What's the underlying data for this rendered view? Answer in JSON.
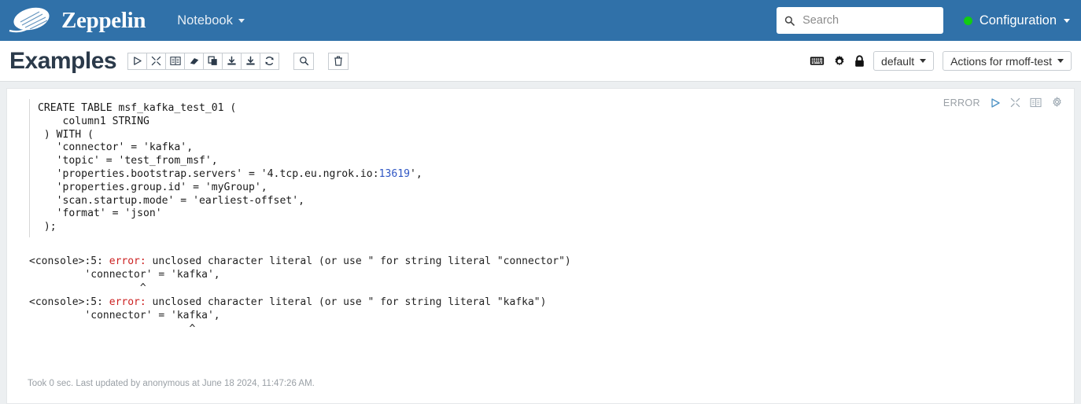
{
  "navbar": {
    "brand_name": "Zeppelin",
    "brand_logo_icon": "zeppelin-airship-logo",
    "nav_items": [
      {
        "label": "Notebook",
        "icon": "chevron-down-icon"
      }
    ],
    "search": {
      "placeholder": "Search",
      "value": "",
      "icon": "search-icon"
    },
    "configuration": {
      "label": "Configuration",
      "status_dot_color": "#12cc12",
      "icon": "chevron-down-icon"
    },
    "background_color": "#3071a9"
  },
  "note_toolbar": {
    "title": "Examples",
    "buttons": [
      {
        "name": "run-all-paragraphs",
        "icon": "play-icon"
      },
      {
        "name": "hide-all-output",
        "icon": "collapse-arrows-icon"
      },
      {
        "name": "toggle-all-code",
        "icon": "book-icon"
      },
      {
        "name": "clear-all-output",
        "icon": "eraser-icon"
      },
      {
        "name": "clone-note",
        "icon": "copy-icon"
      },
      {
        "name": "export-note",
        "icon": "download-icon"
      },
      {
        "name": "import-note",
        "icon": "download-icon"
      },
      {
        "name": "reload-note",
        "icon": "refresh-icon"
      }
    ],
    "search_button": {
      "name": "search-code-button",
      "icon": "search-icon"
    },
    "trash_button": {
      "name": "move-note-to-trash-button",
      "icon": "trash-icon"
    },
    "right_icons": [
      {
        "name": "keyboard-shortcuts",
        "icon": "keyboard-icon"
      },
      {
        "name": "note-settings",
        "icon": "gear-icon"
      },
      {
        "name": "note-permissions",
        "icon": "lock-icon"
      }
    ],
    "interpreter_binding": {
      "label": "default",
      "icon": "chevron-down-icon"
    },
    "actions_menu": {
      "label": "Actions for rmoff-test",
      "icon": "chevron-down-icon"
    }
  },
  "paragraph": {
    "status": "ERROR",
    "controls": [
      {
        "name": "run-paragraph",
        "icon": "play-icon"
      },
      {
        "name": "hide-output",
        "icon": "collapse-arrows-icon"
      },
      {
        "name": "show-editor",
        "icon": "book-icon"
      },
      {
        "name": "paragraph-settings",
        "icon": "gear-icon"
      }
    ],
    "code_lines": [
      "CREATE TABLE msf_kafka_test_01 (",
      "    column1 STRING",
      " ) WITH (",
      "   'connector' = 'kafka',",
      "   'topic' = 'test_from_msf',",
      "   'properties.bootstrap.servers' = '4.tcp.eu.ngrok.io:",
      "   'properties.group.id' = 'myGroup',",
      "   'scan.startup.mode' = 'earliest-offset',",
      "   'format' = 'json'",
      " );"
    ],
    "code_highlight_port": "13619",
    "code_line6_tail": "',",
    "output_lines": [
      {
        "prefix": "<console>:5: ",
        "error": "error:",
        "rest": " unclosed character literal (or use \" for string literal \"connector\")"
      },
      {
        "plain": "         'connector' = 'kafka',"
      },
      {
        "plain": "                  ^"
      },
      {
        "prefix": "<console>:5: ",
        "error": "error:",
        "rest": " unclosed character literal (or use \" for string literal \"kafka\")"
      },
      {
        "plain": "         'connector' = 'kafka',"
      },
      {
        "plain": "                          ^"
      }
    ],
    "footer": "Took 0 sec. Last updated by anonymous at June 18 2024, 11:47:26 AM."
  }
}
